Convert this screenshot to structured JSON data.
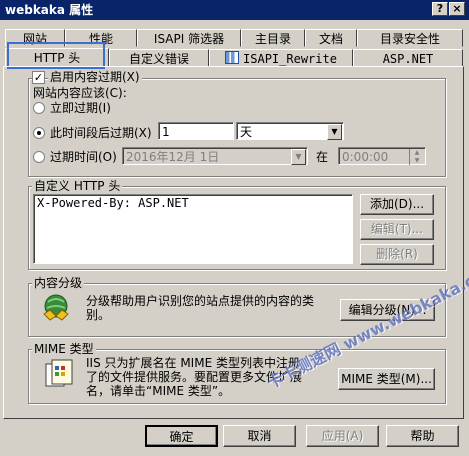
{
  "window": {
    "title": "webkaka 属性",
    "help_btn": "?",
    "close_btn": "×"
  },
  "tabs_row1": [
    "网站",
    "性能",
    "ISAPI 筛选器",
    "主目录",
    "文档",
    "目录安全性"
  ],
  "tabs_row2": [
    "HTTP 头",
    "自定义错误",
    "ISAPI_Rewrite",
    "ASP.NET"
  ],
  "content_expiration": {
    "checkbox_label": "启用内容过期(X)",
    "checked": true,
    "should_label": "网站内容应该(C):",
    "opt_immediate": "立即过期(I)",
    "opt_after": "此时间段后过期(X)",
    "opt_on": "过期时间(O)",
    "after_value": "1",
    "after_unit": "天",
    "date_value": "2016年12月 1日",
    "at_label": "在",
    "time_value": "0:00:00"
  },
  "custom_headers": {
    "legend": "自定义 HTTP 头",
    "items": [
      "X-Powered-By: ASP.NET"
    ],
    "add_btn": "添加(D)...",
    "edit_btn": "编辑(T)...",
    "delete_btn": "删除(R)"
  },
  "content_rating": {
    "legend": "内容分级",
    "description": "分级帮助用户识别您的站点提供的内容的类别。",
    "desc_line1": "分级帮助用户识别您的站点提供的内容的类",
    "desc_line2": "别。",
    "edit_btn": "编辑分级(N)..."
  },
  "mime": {
    "legend": "MIME 类型",
    "line1": "IIS 只为扩展名在 MIME 类型列表中注册",
    "line2": "了的文件提供服务。要配置更多文件扩展",
    "line3": "名，请单击“MIME 类型”。",
    "btn": "MIME 类型(M)..."
  },
  "footer": {
    "ok": "确定",
    "cancel": "取消",
    "apply": "应用(A)",
    "help": "帮助"
  },
  "watermark": {
    "text": "卡卡测速网 www.webkaka.com"
  },
  "colors": {
    "titlebar": "#0a246a",
    "face": "#d4d0c8",
    "highlight_box": "#3c6fd1"
  }
}
